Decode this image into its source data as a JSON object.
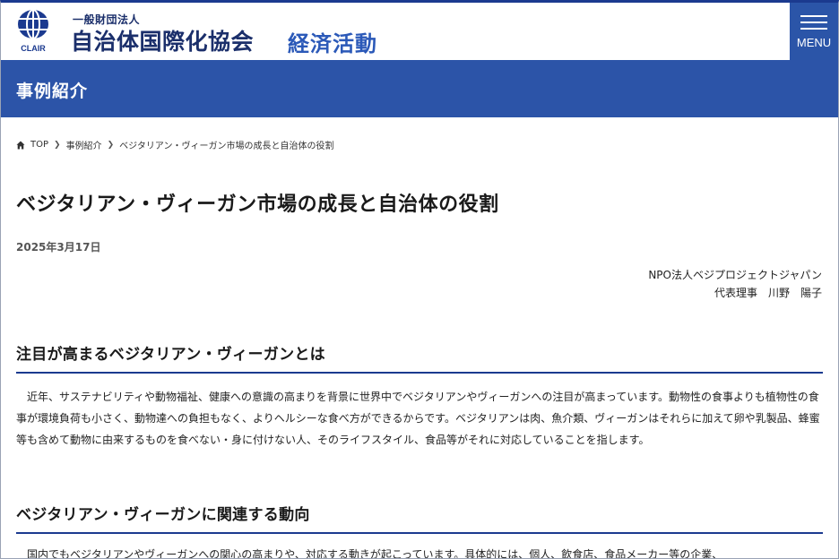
{
  "header": {
    "org_kind": "一般財団法人",
    "org_name": "自治体国際化協会",
    "section_name": "経済活動",
    "logo_text": "CLAIR",
    "menu_label": "MENU"
  },
  "category": {
    "title": "事例紹介"
  },
  "breadcrumb": {
    "items": [
      "TOP",
      "事例紹介",
      "ベジタリアン・ヴィーガン市場の成長と自治体の役割"
    ]
  },
  "article": {
    "title": "ベジタリアン・ヴィーガン市場の成長と自治体の役割",
    "date": "2025年3月17日",
    "author_org": "NPO法人ベジプロジェクトジャパン",
    "author_role_name": "代表理事　川野　陽子",
    "sections": [
      {
        "heading": "注目が高まるベジタリアン・ヴィーガンとは",
        "body": "近年、サステナビリティや動物福祉、健康への意識の高まりを背景に世界中でベジタリアンやヴィーガンへの注目が高まっています。動物性の食事よりも植物性の食事が環境負荷も小さく、動物達への負担もなく、よりヘルシーな食べ方ができるからです。ベジタリアンは肉、魚介類、ヴィーガンはそれらに加えて卵や乳製品、蜂蜜等も含めて動物に由来するものを食べない・身に付けない人、そのライフスタイル、食品等がそれに対応していることを指します。"
      },
      {
        "heading": "ベジタリアン・ヴィーガンに関連する動向",
        "body": "国内でもベジタリアンやヴィーガンへの関心の高まりや、対応する動きが起こっています。具体的には、個人、飲食店、食品メーカー等の企業、"
      }
    ]
  },
  "colors": {
    "brand_navy": "#1b2f6b",
    "brand_blue": "#2c54a8",
    "accent_blue": "#2b59b8"
  }
}
